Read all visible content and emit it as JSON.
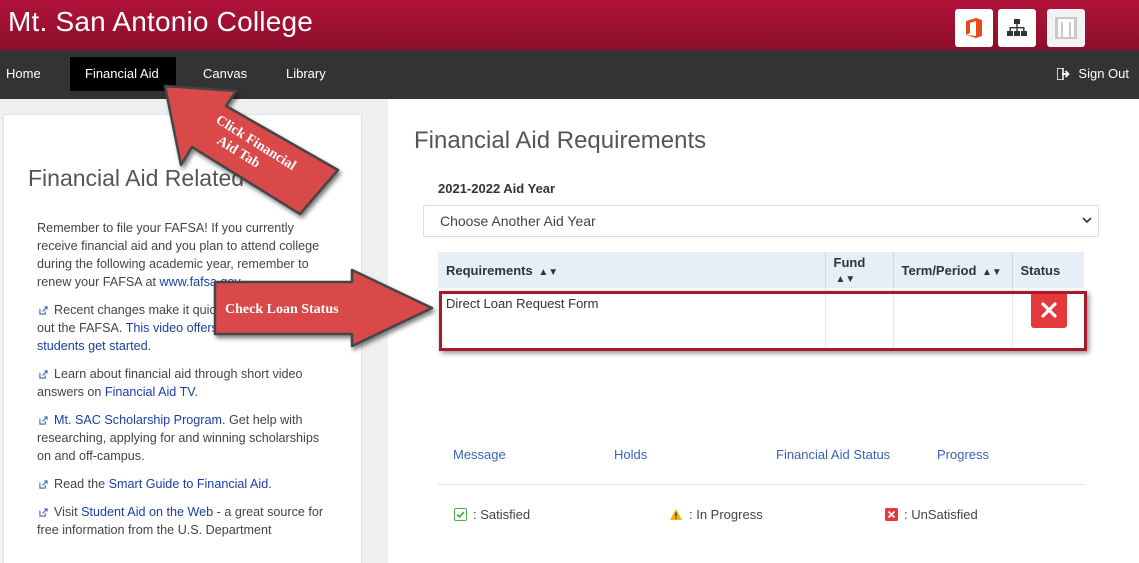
{
  "header": {
    "brand": "Mt. San Antonio College",
    "icons": [
      "office-icon",
      "sitemap-icon",
      "user-icon"
    ]
  },
  "nav": {
    "items": [
      "Home",
      "Financial Aid",
      "Canvas",
      "Library"
    ],
    "active": "Financial Aid",
    "signout": "Sign Out"
  },
  "left": {
    "title": "Financial Aid Related Links",
    "p1_text": "Remember to file your FAFSA!  If you currently receive financial aid and you plan to attend college during the following academic year, remember to renew your FAFSA at ",
    "p1_link": "www.fafsa.gov",
    "p1_end": ".",
    "p2_text": "Recent changes make it quicker and easier to fill out the FAFSA. ",
    "p2_link": "This video offers tips to help students get started.",
    "p3_text": "Learn about financial aid through short video answers on ",
    "p3_link": "Financial Aid TV",
    "p3_end": ".",
    "p4_link": "Mt. SAC Scholarship Program",
    "p4_text": ". Get help with researching, applying for and winning scholarships on and off-campus.",
    "p5_text": "Read the ",
    "p5_link": "Smart Guide to Financial Aid",
    "p5_end": ".",
    "p6_text": "Visit ",
    "p6_link": "Student Aid on the Web",
    "p6_end": " - a great source for free information from the U.S. Department"
  },
  "main": {
    "title": "Financial Aid Requirements",
    "aid_year": "2021-2022 Aid Year",
    "select_value": "Choose Another Aid Year",
    "table": {
      "headers": [
        "Requirements",
        "Fund",
        "Term/Period",
        "Status"
      ],
      "rows": [
        {
          "requirement": "Direct Loan Request Form",
          "fund": "",
          "term": "",
          "status": "unsatisfied"
        }
      ]
    },
    "tabs": [
      "Message",
      "Holds",
      "Financial Aid Status",
      "Progress"
    ],
    "legend": {
      "satisfied": ": Satisfied",
      "in_progress": ": In Progress",
      "unsatisfied": ": UnSatisfied"
    }
  },
  "callouts": {
    "tab": "Click Financial Aid Tab",
    "tab_line1": "Click Financial",
    "tab_line2": "Aid Tab",
    "loan": "Check Loan Status"
  },
  "colors": {
    "header": "#a3112f",
    "nav": "#333333",
    "arrow": "#d94a4a",
    "link": "#1a3fa8",
    "status_red": "#e5383b"
  }
}
